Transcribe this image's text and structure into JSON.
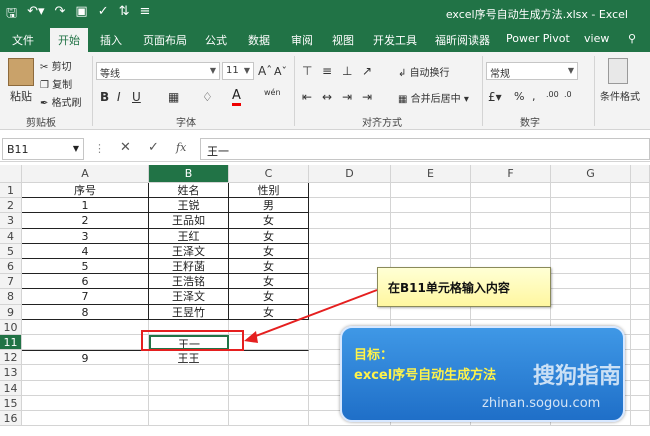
{
  "app": {
    "title": "excel序号自动生成方法.xlsx  -  Excel",
    "qat": [
      "save-icon",
      "undo-icon",
      "redo-icon"
    ]
  },
  "tabs": [
    "文件",
    "开始",
    "插入",
    "页面布局",
    "公式",
    "数据",
    "审阅",
    "视图",
    "开发工具",
    "福昕阅读器",
    "Power Pivot",
    "view"
  ],
  "active_tab": "开始",
  "ribbon": {
    "paste": "粘贴",
    "cut": "剪切",
    "copy": "复制",
    "format_painter": "格式刷",
    "clipboard": "剪贴板",
    "font_name": "等线",
    "font_size": "11",
    "font": "字体",
    "wrap": "自动换行",
    "merge": "合并后居中",
    "align": "对齐方式",
    "number_format": "常规",
    "number": "数字",
    "cond_format": "条件格式",
    "bold": "B",
    "italic": "I",
    "underline": "U"
  },
  "formula_bar": {
    "name_box": "B11",
    "fx": "fx",
    "content": "王一"
  },
  "columns": [
    "A",
    "B",
    "C",
    "D",
    "E",
    "F",
    "G"
  ],
  "rows": [
    "1",
    "2",
    "3",
    "4",
    "5",
    "6",
    "7",
    "8",
    "9",
    "10",
    "11",
    "12",
    "13",
    "14",
    "15",
    "16"
  ],
  "table": [
    [
      "序号",
      "姓名",
      "性别"
    ],
    [
      "1",
      "王锐",
      "男"
    ],
    [
      "2",
      "王品如",
      "女"
    ],
    [
      "3",
      "王红",
      "女"
    ],
    [
      "4",
      "王泽文",
      "女"
    ],
    [
      "5",
      "王籽菡",
      "女"
    ],
    [
      "6",
      "王浩铭",
      "女"
    ],
    [
      "7",
      "王泽文",
      "女"
    ],
    [
      "8",
      "王昱竹",
      "女"
    ],
    [
      "",
      "",
      ""
    ],
    [
      "",
      "王一",
      ""
    ],
    [
      "9",
      "王王",
      ""
    ]
  ],
  "annotation": {
    "callout": "在B11单元格输入内容",
    "goal_title": "目标：",
    "goal_text": "excel序号自动生成方法",
    "watermark": "搜狗指南",
    "watermark_url": "zhinan.sogou.com"
  }
}
